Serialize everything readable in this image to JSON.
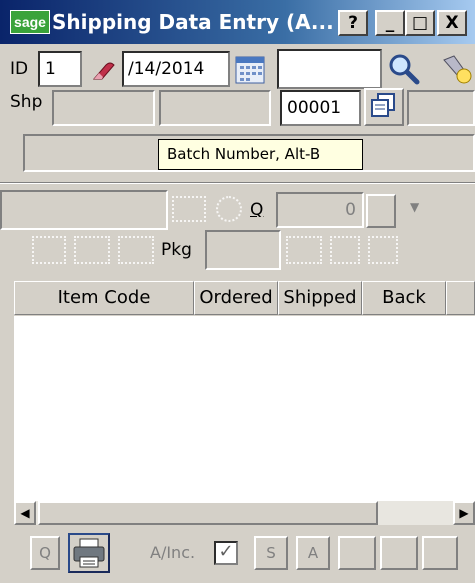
{
  "window": {
    "logo": "sage",
    "title": "Shipping Data Entry (A...",
    "caption_buttons": {
      "help": "?",
      "minimize": "_",
      "maximize": "□",
      "close": "X"
    }
  },
  "header": {
    "id_label": "ID",
    "id_value": "1",
    "date_value": "/14/2014",
    "shp_label": "Shp",
    "batch_value": "00001",
    "tooltip": "Batch Number, Alt-B"
  },
  "row3": {
    "q_label": "Q",
    "qty_value": "0",
    "pkg_label": "Pkg"
  },
  "grid": {
    "columns": [
      "Item Code",
      "Ordered",
      "Shipped",
      "Back"
    ]
  },
  "toolbar": {
    "q_label": "Q",
    "ainc_label": "A/Inc.",
    "ainc_checked": true,
    "s_label": "S",
    "a_label": "A"
  }
}
